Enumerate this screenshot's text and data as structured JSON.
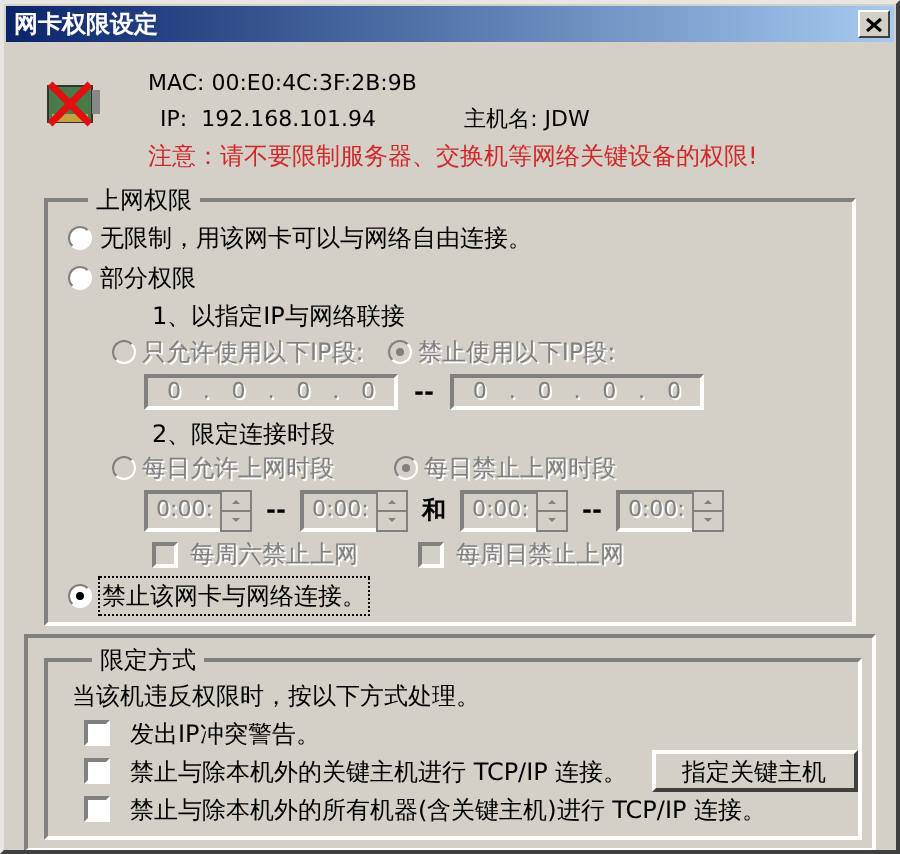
{
  "window": {
    "title": "网卡权限设定"
  },
  "info": {
    "mac": "MAC: 00:E0:4C:3F:2B:9B",
    "ip": "IP:  192.168.101.94",
    "hostname": "主机名: JDW",
    "warning": "注意：请不要限制服务器、交换机等网络关键设备的权限!"
  },
  "access": {
    "title": "上网权限",
    "unrestricted": {
      "label": "无限制，用该网卡可以与网络自由连接。",
      "selected": false
    },
    "partial": {
      "label": "部分权限",
      "selected": false
    },
    "ip_rule": {
      "heading": "1、以指定IP与网络联接",
      "disabled": true,
      "options": [
        {
          "label": "只允许使用以下IP段:",
          "selected": false
        },
        {
          "label": "禁止使用以下IP段:",
          "selected": true
        }
      ],
      "dot": ".",
      "dash": "--",
      "from": [
        "0",
        "0",
        "0",
        "0"
      ],
      "to": [
        "0",
        "0",
        "0",
        "0"
      ]
    },
    "time_rule": {
      "heading": "2、限定连接时段",
      "disabled": true,
      "options": [
        {
          "label": "每日允许上网时段",
          "selected": false
        },
        {
          "label": "每日禁止上网时段",
          "selected": true
        }
      ],
      "dash": "--",
      "and": "和",
      "periods": [
        {
          "from": "0:00:",
          "to": "0:00:"
        },
        {
          "from": "0:00:",
          "to": "0:00:"
        }
      ],
      "weekend": [
        {
          "label": "每周六禁止上网",
          "checked": false
        },
        {
          "label": "每周日禁止上网",
          "checked": false
        }
      ]
    },
    "block": {
      "label": "禁止该网卡与网络连接。",
      "selected": true,
      "focused": true
    }
  },
  "limit": {
    "title": "限定方式",
    "description": "当该机违反权限时，按以下方式处理。",
    "actions": [
      {
        "label": "发出IP冲突警告。",
        "checked": false
      },
      {
        "label": "禁止与除本机外的关键主机进行 TCP/IP 连接。",
        "checked": false,
        "button": "指定关键主机"
      },
      {
        "label": "禁止与除本机外的所有机器(含关键主机)进行 TCP/IP 连接。",
        "checked": false
      }
    ]
  }
}
